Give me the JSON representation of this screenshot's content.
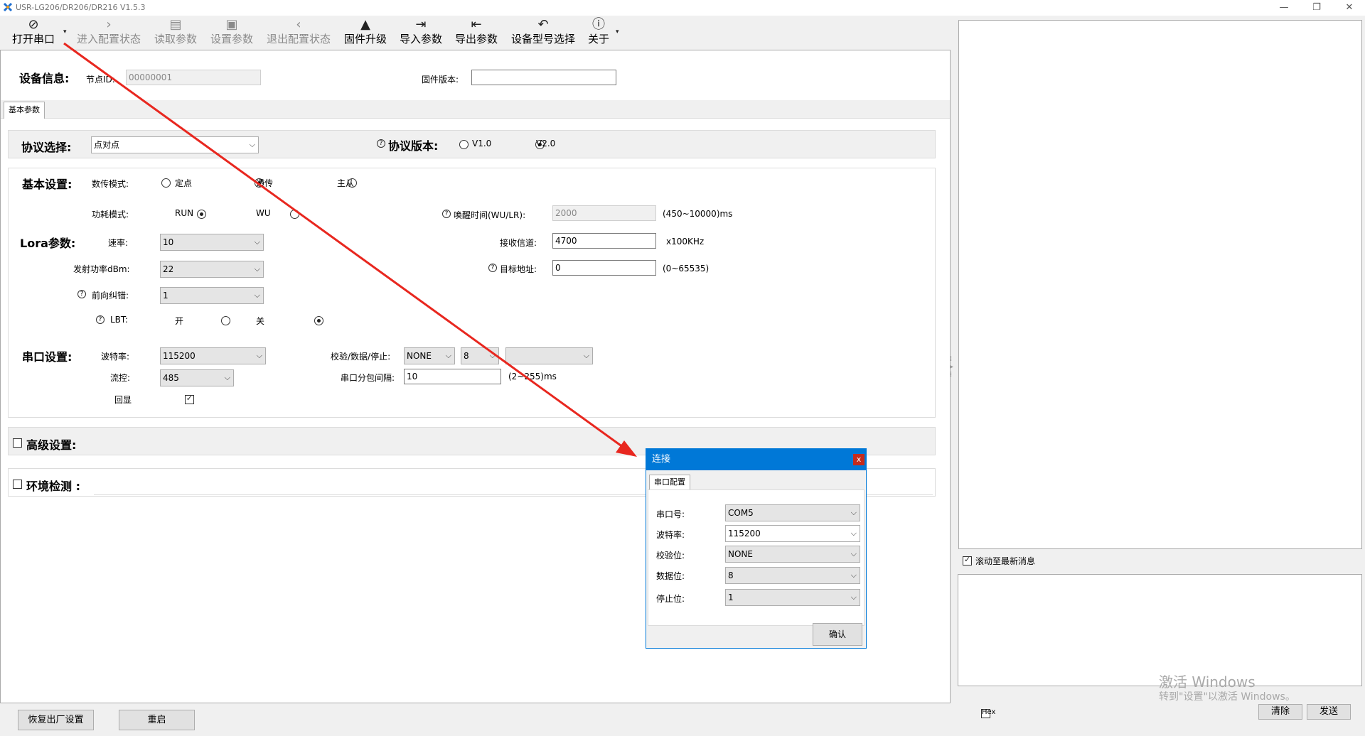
{
  "window": {
    "title": "USR-LG206/DR206/DR216 V1.5.3"
  },
  "toolbar": {
    "open_port": "打开串口",
    "enter_config": "进入配置状态",
    "read_params": "读取参数",
    "set_params": "设置参数",
    "exit_config": "退出配置状态",
    "firmware_upgrade": "固件升级",
    "import_params": "导入参数",
    "export_params": "导出参数",
    "device_model": "设备型号选择",
    "about": "关于"
  },
  "device_info": {
    "label": "设备信息:",
    "node_id_label": "节点ID:",
    "node_id_value": "00000001",
    "firmware_label": "固件版本:",
    "firmware_value": ""
  },
  "tab": {
    "basic": "基本参数"
  },
  "protocol": {
    "label": "协议选择:",
    "value": "点对点",
    "version_label": "协议版本:",
    "v1": "V1.0",
    "v2": "V2.0"
  },
  "basic": {
    "label": "基本设置:",
    "trans_mode_label": "数传模式:",
    "mode_fixed": "定点",
    "mode_transparent": "透传",
    "mode_master": "主从",
    "power_mode_label": "功耗模式:",
    "power_run": "RUN",
    "power_wu": "WU",
    "wake_label": "唤醒时间(WU/LR):",
    "wake_value": "2000",
    "wake_range": "(450~10000)ms"
  },
  "lora": {
    "label": "Lora参数:",
    "rate_label": "速率:",
    "rate_value": "10",
    "power_label": "发射功率dBm:",
    "power_value": "22",
    "fec_label": "前向纠错:",
    "fec_value": "1",
    "lbt_label": "LBT:",
    "lbt_on": "开",
    "lbt_off": "关",
    "channel_label": "接收信道:",
    "channel_value": "4700",
    "channel_unit": "x100KHz",
    "target_label": "目标地址:",
    "target_value": "0",
    "target_range": "(0~65535)"
  },
  "serial": {
    "label": "串口设置:",
    "baud_label": "波特率:",
    "baud_value": "115200",
    "flow_label": "流控:",
    "flow_value": "485",
    "echo_label": "回显",
    "parity_label": "校验/数据/停止:",
    "parity_value": "NONE",
    "data_value": "8",
    "stop_value": "",
    "interval_label": "串口分包间隔:",
    "interval_value": "10",
    "interval_range": "(2~255)ms"
  },
  "advanced": {
    "label": "高级设置:"
  },
  "env": {
    "label": "环境检测 :"
  },
  "bottom": {
    "factory_reset": "恢复出厂设置",
    "restart": "重启"
  },
  "right": {
    "scroll_label": "滚动至最新消息",
    "hex_label": "Hex",
    "clear": "清除",
    "send": "发送",
    "watermark_title": "激活 Windows",
    "watermark_sub": "转到\"设置\"以激活 Windows。"
  },
  "dialog": {
    "title": "连接",
    "tab": "串口配置",
    "port_label": "串口号:",
    "port_value": "COM5",
    "baud_label": "波特率:",
    "baud_value": "115200",
    "parity_label": "校验位:",
    "parity_value": "NONE",
    "data_label": "数据位:",
    "data_value": "8",
    "stop_label": "停止位:",
    "stop_value": "1",
    "confirm": "确认",
    "close": "x"
  },
  "colors": {
    "accent": "#0078d7",
    "arrow": "#e8271f",
    "close": "#c42b1c"
  }
}
